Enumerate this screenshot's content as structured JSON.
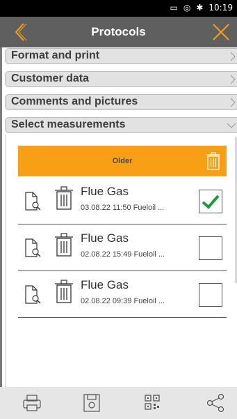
{
  "status_bar": {
    "time": "10:19",
    "icons": [
      "cast-icon",
      "wifi-icon",
      "bluetooth-icon"
    ]
  },
  "header": {
    "title": "Protocols"
  },
  "sections": [
    {
      "label": "Format and print"
    },
    {
      "label": "Customer data"
    },
    {
      "label": "Comments and pictures"
    },
    {
      "label": "Select measurements",
      "expanded": true
    }
  ],
  "group": {
    "label": "Older"
  },
  "measurements": [
    {
      "name": "Flue Gas",
      "meta": "03.08.22  11:50  Fueloil ...",
      "checked": true
    },
    {
      "name": "Flue Gas",
      "meta": "02.08.22  15:49  Fueloil ...",
      "checked": false
    },
    {
      "name": "Flue Gas",
      "meta": "02.08.22  09:39  Fueloil ...",
      "checked": false
    }
  ],
  "bottom_bar": [
    "print-icon",
    "save-icon",
    "qr-code-icon",
    "share-icon"
  ],
  "colors": {
    "accent": "#f7a015",
    "header": "#5f5f5f",
    "check": "#1e9b3b"
  }
}
